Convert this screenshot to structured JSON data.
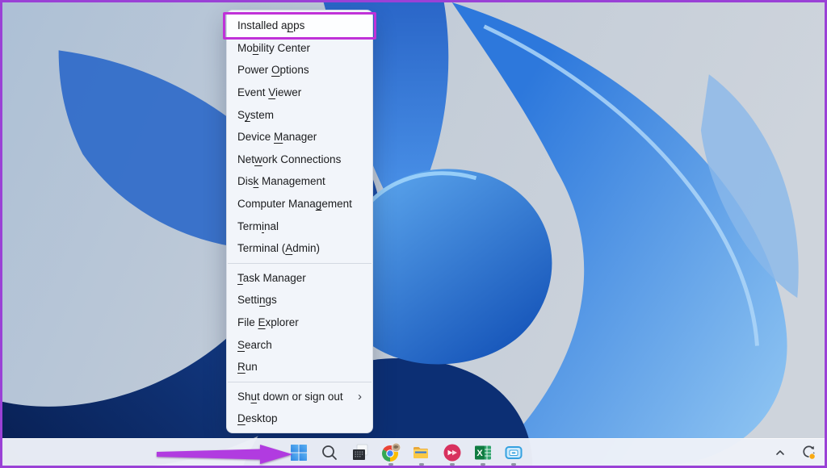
{
  "colors": {
    "highlight_box": "#c032d8",
    "annotation_arrow": "#b13be0",
    "frame_border": "#9a41d6",
    "taskbar_bg": "#edf1f8",
    "menu_bg": "#f2f5fa"
  },
  "context_menu": {
    "submenu_chevron": "›",
    "items": [
      {
        "name": "installed-apps",
        "pre": "Installed a",
        "key": "p",
        "post": "ps",
        "highlighted": true
      },
      {
        "name": "mobility-center",
        "pre": "Mo",
        "key": "b",
        "post": "ility Center"
      },
      {
        "name": "power-options",
        "pre": "Power ",
        "key": "O",
        "post": "ptions"
      },
      {
        "name": "event-viewer",
        "pre": "Event ",
        "key": "V",
        "post": "iewer"
      },
      {
        "name": "system",
        "pre": "S",
        "key": "y",
        "post": "stem"
      },
      {
        "name": "device-manager",
        "pre": "Device ",
        "key": "M",
        "post": "anager"
      },
      {
        "name": "network-connections",
        "pre": "Net",
        "key": "w",
        "post": "ork Connections"
      },
      {
        "name": "disk-management",
        "pre": "Dis",
        "key": "k",
        "post": " Management"
      },
      {
        "name": "computer-management",
        "pre": "Computer Mana",
        "key": "g",
        "post": "ement"
      },
      {
        "name": "terminal",
        "pre": "Term",
        "key": "i",
        "post": "nal"
      },
      {
        "name": "terminal-admin",
        "pre": "Terminal (",
        "key": "A",
        "post": "dmin)"
      },
      {
        "separator": true
      },
      {
        "name": "task-manager",
        "pre": "",
        "key": "T",
        "post": "ask Manager"
      },
      {
        "name": "settings",
        "pre": "Setti",
        "key": "n",
        "post": "gs"
      },
      {
        "name": "file-explorer",
        "pre": "File ",
        "key": "E",
        "post": "xplorer"
      },
      {
        "name": "search",
        "pre": "",
        "key": "S",
        "post": "earch"
      },
      {
        "name": "run",
        "pre": "",
        "key": "R",
        "post": "un"
      },
      {
        "separator": true
      },
      {
        "name": "shut-down-or-sign-out",
        "pre": "Sh",
        "key": "u",
        "post": "t down or sign out",
        "submenu": true
      },
      {
        "name": "desktop",
        "pre": "",
        "key": "D",
        "post": "esktop"
      }
    ]
  },
  "taskbar": {
    "icons": [
      {
        "name": "start",
        "running": false
      },
      {
        "name": "search",
        "running": false
      },
      {
        "name": "dark-window-app",
        "running": false
      },
      {
        "name": "chrome",
        "running": true
      },
      {
        "name": "file-explorer",
        "running": true
      },
      {
        "name": "red-circle-app",
        "running": true
      },
      {
        "name": "excel",
        "running": true
      },
      {
        "name": "blue-window-app",
        "running": true
      }
    ],
    "tray": [
      {
        "name": "show-hidden-icons"
      },
      {
        "name": "windows-update"
      }
    ]
  }
}
